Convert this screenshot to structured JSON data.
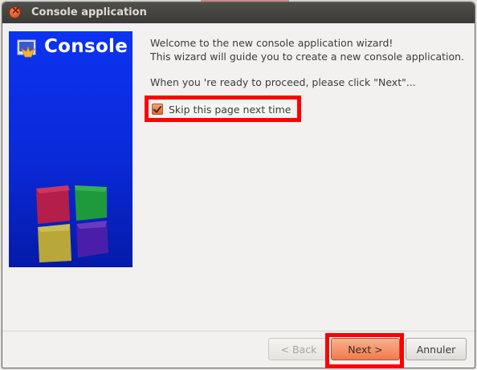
{
  "window": {
    "title": "Console application"
  },
  "banner": {
    "title": "Console"
  },
  "content": {
    "line1": "Welcome to the new console application wizard!",
    "line2": "This wizard will guide you to create a new console application.",
    "ready": "When you 're ready to proceed, please click \"Next\"..."
  },
  "skip": {
    "label": "Skip this page next time",
    "checked": true
  },
  "buttons": {
    "back": "< Back",
    "next": "Next >",
    "cancel": "Annuler"
  },
  "colors": {
    "banner_blue": "#0c33f0",
    "accent_orange": "#ef7a4c",
    "highlight": "#ff0000"
  }
}
